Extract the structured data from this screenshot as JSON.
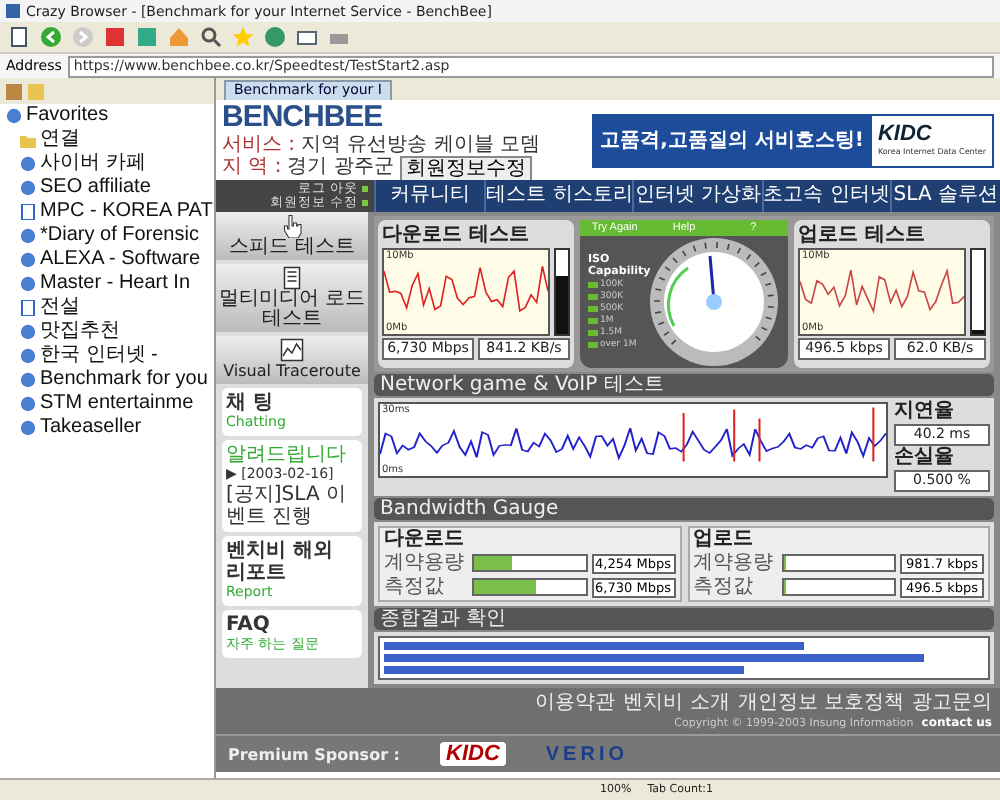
{
  "window": {
    "title": "Crazy Browser - [Benchmark for your Internet Service - BenchBee]"
  },
  "address_bar": {
    "label": "Address",
    "value": "https://www.benchbee.co.kr/Speedtest/TestStart2.asp"
  },
  "favorites": {
    "title": "Favorites",
    "items": [
      {
        "label": "연결",
        "kind": "folder"
      },
      {
        "label": "사이버 카페",
        "kind": "link"
      },
      {
        "label": "SEO affiliate",
        "kind": "link"
      },
      {
        "label": "MPC - KOREA PAT",
        "kind": "page"
      },
      {
        "label": "*Diary of Forensic",
        "kind": "link"
      },
      {
        "label": "ALEXA - Software",
        "kind": "link"
      },
      {
        "label": "Master - Heart In",
        "kind": "link"
      },
      {
        "label": "전설",
        "kind": "page"
      },
      {
        "label": "맛집추천",
        "kind": "link"
      },
      {
        "label": "한국 인터넷 -",
        "kind": "link"
      },
      {
        "label": "Benchmark for you",
        "kind": "link"
      },
      {
        "label": "STM entertainme",
        "kind": "link"
      },
      {
        "label": "Takeaseller",
        "kind": "link"
      }
    ]
  },
  "tab": {
    "label": "Benchmark for your I"
  },
  "page": {
    "header": {
      "logo": "BENCHBEE",
      "service_label": "서비스 :",
      "service": "지역 유선방송 케이블 모뎀",
      "region_label": "지 역 :",
      "region": "경기 광주군",
      "edit_button": "회원정보수정"
    },
    "banner": {
      "text": "고품격,고품질의 서비호스팅!",
      "logo": "KIDC",
      "logo_caption": "Korea Internet Data Center"
    },
    "account_links": [
      "로그 아웃",
      "회원정보 수정"
    ],
    "nav": [
      "커뮤니티",
      "테스트 히스토리",
      "인터넷 가상화",
      "초고속 인터넷",
      "SLA 솔루션"
    ],
    "side_menu": [
      {
        "label": "스피드 테스트",
        "kind": "hand"
      },
      {
        "label": "멀티미디어 로드 테스트",
        "kind": "document"
      },
      {
        "label": "Visual Traceroute",
        "kind": "chart"
      }
    ],
    "chat_card": {
      "title": "채 팅",
      "subtitle": "Chatting"
    },
    "notice": {
      "title": "알려드립니다",
      "date": "▶ [2003-02-16]",
      "text": "[공지]SLA 이벤트 진행"
    },
    "report_card": {
      "title": "벤치비 해외 리포트",
      "subtitle": "Report"
    },
    "faq_card": {
      "title": "FAQ",
      "subtitle": "자주 하는 질문"
    },
    "download": {
      "title": "다운로드 테스트",
      "max": "10Mb",
      "min": "0Mb",
      "speed": "6,730 Mbps",
      "rate": "841.2 KB/s",
      "level": 0.7
    },
    "gauge": {
      "title": "ISO Capability",
      "legend": [
        "100K",
        "300K",
        "500K",
        "1M",
        "1.5M",
        "over 1M"
      ],
      "buttons": [
        "Try Again",
        "Help",
        "?"
      ]
    },
    "upload": {
      "title": "업로드 테스트",
      "max": "10Mb",
      "min": "0Mb",
      "speed": "496.5 kbps",
      "rate": "62.0 KB/s",
      "level": 0.05
    },
    "network": {
      "title": "Network game & VoIP 테스트",
      "max": "30ms",
      "min": "0ms",
      "latency_label": "지연율",
      "latency": "40.2 ms",
      "loss_label": "손실율",
      "loss": "0.500 %"
    },
    "bandwidth": {
      "title": "Bandwidth Gauge",
      "groups": [
        {
          "title": "다운로드",
          "rows": [
            {
              "label": "계약용량",
              "level": 0.35,
              "value": "4,254 Mbps"
            },
            {
              "label": "측정값",
              "level": 0.55,
              "value": "6,730 Mbps"
            }
          ]
        },
        {
          "title": "업로드",
          "rows": [
            {
              "label": "계약용량",
              "level": 0.03,
              "value": "981.7 kbps"
            },
            {
              "label": "측정값",
              "level": 0.03,
              "value": "496.5 kbps"
            }
          ]
        }
      ]
    },
    "result": {
      "title": "종합결과 확인"
    },
    "footer": {
      "links": [
        "이용약관",
        "벤치비 소개",
        "개인정보 보호정책",
        "광고문의"
      ],
      "copyright": "Copyright © 1999-2003 Insung Information",
      "contact": "contact us",
      "sponsor_label": "Premium Sponsor :",
      "sponsors": [
        "KIDC",
        "VERIO"
      ]
    }
  },
  "status_bar": {
    "zoom": "100%",
    "tab_count": "Tab Count:1"
  }
}
